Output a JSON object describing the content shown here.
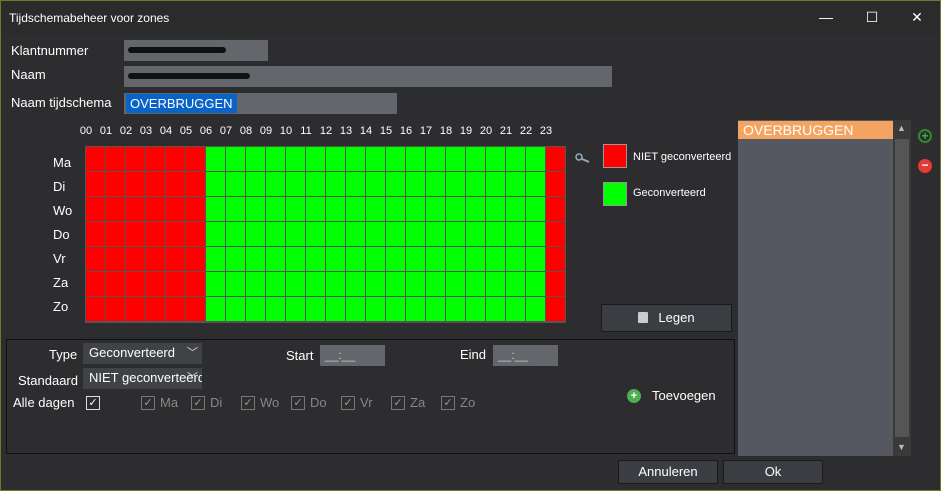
{
  "window": {
    "title": "Tijdschemabeheer voor zones",
    "minimize": "—",
    "maximize": "☐",
    "close": "✕"
  },
  "form": {
    "klantnummer_label": "Klantnummer",
    "naam_label": "Naam",
    "naam_tijdschema_label": "Naam tijdschema",
    "naam_tijdschema_value": "OVERBRUGGEN"
  },
  "grid": {
    "hours": [
      "00",
      "01",
      "02",
      "03",
      "04",
      "05",
      "06",
      "07",
      "08",
      "09",
      "10",
      "11",
      "12",
      "13",
      "14",
      "15",
      "16",
      "17",
      "18",
      "19",
      "20",
      "21",
      "22",
      "23"
    ],
    "days": [
      "Ma",
      "Di",
      "Wo",
      "Do",
      "Vr",
      "Za",
      "Zo"
    ],
    "green_from_hour": 6,
    "green_to_hour": 22
  },
  "legend": {
    "not_converted_label": "NIET geconverteerd",
    "converted_label": "Geconverteerd",
    "not_converted_color": "#ff0000",
    "converted_color": "#00ff00",
    "clear_button": "Legen"
  },
  "editor": {
    "type_label": "Type",
    "type_value": "Geconverteerd",
    "standaard_label": "Standaard",
    "standaard_value": "NIET geconverteerd",
    "start_label": "Start",
    "start_value": "__:__",
    "eind_label": "Eind",
    "eind_value": "__:__",
    "alle_dagen_label": "Alle dagen",
    "day_checkboxes": [
      "Ma",
      "Di",
      "Wo",
      "Do",
      "Vr",
      "Za",
      "Zo"
    ],
    "add_button": "Toevoegen"
  },
  "schedule_list": {
    "items": [
      "OVERBRUGGEN"
    ]
  },
  "footer": {
    "cancel_button": "Annuleren",
    "ok_button": "Ok"
  }
}
